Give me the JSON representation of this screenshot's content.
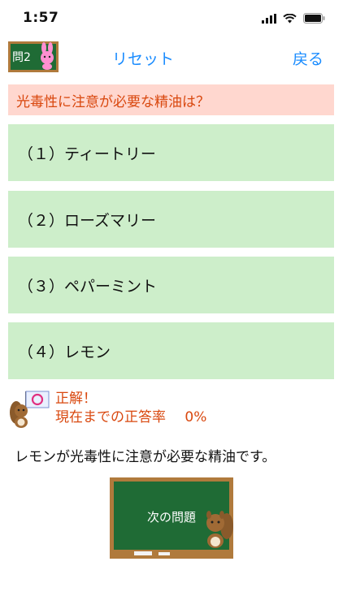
{
  "status": {
    "time": "1:57"
  },
  "header": {
    "question_badge": "問2",
    "reset_label": "リセット",
    "back_label": "戻る"
  },
  "question": {
    "text": "光毒性に注意が必要な精油は？"
  },
  "choices": [
    {
      "label": "（１）ティートリー"
    },
    {
      "label": "（２）ローズマリー"
    },
    {
      "label": "（３）ペパーミント"
    },
    {
      "label": "（４）レモン"
    }
  ],
  "result": {
    "verdict": "正解！",
    "rate_label": "現在までの正答率",
    "rate_value": "0%"
  },
  "explanation": {
    "text": "レモンが光毒性に注意が必要な精油です。"
  },
  "next_button": {
    "label": "次の問題"
  },
  "colors": {
    "link_blue": "#1a8cff",
    "question_bg": "#ffd7cf",
    "question_text": "#d9480f",
    "choice_bg": "#cdeeca",
    "chalkboard": "#1f6b35",
    "frame": "#b07a3c"
  },
  "icons": [
    "wifi-icon",
    "battery-icon",
    "signal-icon",
    "rabbit-icon",
    "squirrel-icon",
    "correct-circle-flag-icon"
  ]
}
